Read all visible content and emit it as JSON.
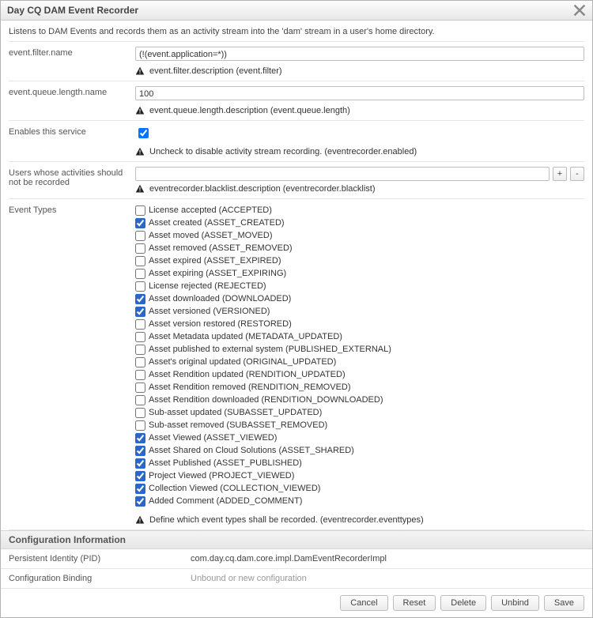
{
  "title": "Day CQ DAM Event Recorder",
  "description": "Listens to DAM Events and records them as an activity stream into the 'dam' stream in a user's home directory.",
  "fields": {
    "filter": {
      "label": "event.filter.name",
      "value": "(!(event.application=*))",
      "hint": "event.filter.description (event.filter)"
    },
    "queue": {
      "label": "event.queue.length.name",
      "value": "100",
      "hint": "event.queue.length.description (event.queue.length)"
    },
    "enabled": {
      "label": "Enables this service",
      "checked": true,
      "hint": "Uncheck to disable activity stream recording. (eventrecorder.enabled)"
    },
    "blacklist": {
      "label": "Users whose activities should not be recorded",
      "value": "",
      "hint": "eventrecorder.blacklist.description (eventrecorder.blacklist)"
    },
    "eventTypes": {
      "label": "Event Types",
      "hint": "Define which event types shall be recorded. (eventrecorder.eventtypes)",
      "items": [
        {
          "label": "License accepted (ACCEPTED)",
          "checked": false
        },
        {
          "label": "Asset created (ASSET_CREATED)",
          "checked": true
        },
        {
          "label": "Asset moved (ASSET_MOVED)",
          "checked": false
        },
        {
          "label": "Asset removed (ASSET_REMOVED)",
          "checked": false
        },
        {
          "label": "Asset expired (ASSET_EXPIRED)",
          "checked": false
        },
        {
          "label": "Asset expiring (ASSET_EXPIRING)",
          "checked": false
        },
        {
          "label": "License rejected (REJECTED)",
          "checked": false
        },
        {
          "label": "Asset downloaded (DOWNLOADED)",
          "checked": true
        },
        {
          "label": "Asset versioned (VERSIONED)",
          "checked": true
        },
        {
          "label": "Asset version restored (RESTORED)",
          "checked": false
        },
        {
          "label": "Asset Metadata updated (METADATA_UPDATED)",
          "checked": false
        },
        {
          "label": "Asset published to external system (PUBLISHED_EXTERNAL)",
          "checked": false
        },
        {
          "label": "Asset's original updated (ORIGINAL_UPDATED)",
          "checked": false
        },
        {
          "label": "Asset Rendition updated (RENDITION_UPDATED)",
          "checked": false
        },
        {
          "label": "Asset Rendition removed (RENDITION_REMOVED)",
          "checked": false
        },
        {
          "label": "Asset Rendition downloaded (RENDITION_DOWNLOADED)",
          "checked": false
        },
        {
          "label": "Sub-asset updated (SUBASSET_UPDATED)",
          "checked": false
        },
        {
          "label": "Sub-asset removed (SUBASSET_REMOVED)",
          "checked": false
        },
        {
          "label": "Asset Viewed (ASSET_VIEWED)",
          "checked": true
        },
        {
          "label": "Asset Shared on Cloud Solutions (ASSET_SHARED)",
          "checked": true
        },
        {
          "label": "Asset Published (ASSET_PUBLISHED)",
          "checked": true
        },
        {
          "label": "Project Viewed (PROJECT_VIEWED)",
          "checked": true
        },
        {
          "label": "Collection Viewed (COLLECTION_VIEWED)",
          "checked": true
        },
        {
          "label": "Added Comment (ADDED_COMMENT)",
          "checked": true
        }
      ]
    }
  },
  "configInfo": {
    "header": "Configuration Information",
    "pid": {
      "label": "Persistent Identity (PID)",
      "value": "com.day.cq.dam.core.impl.DamEventRecorderImpl"
    },
    "binding": {
      "label": "Configuration Binding",
      "value": "Unbound or new configuration"
    }
  },
  "buttons": {
    "cancel": "Cancel",
    "reset": "Reset",
    "delete": "Delete",
    "unbind": "Unbind",
    "save": "Save",
    "add": "+",
    "remove": "-"
  }
}
